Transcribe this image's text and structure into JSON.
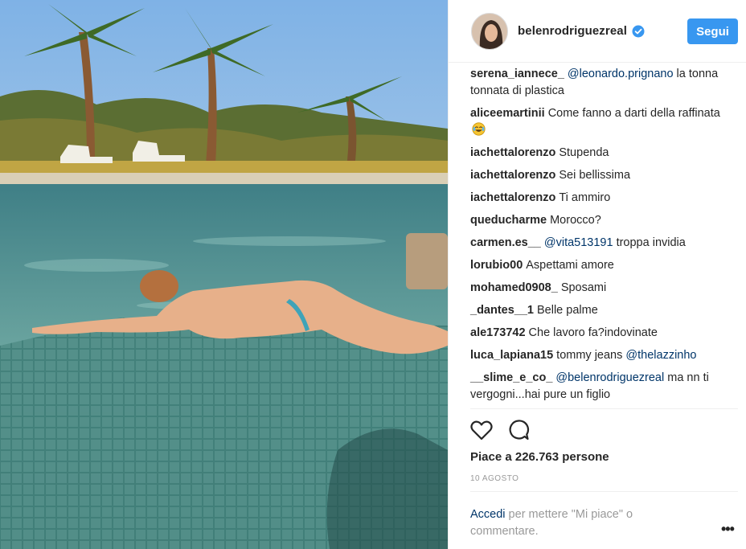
{
  "post": {
    "username": "belenrodriguezreal",
    "follow_label": "Segui",
    "likes_text": "Piace a 226.763 persone",
    "date": "10 AGOSTO",
    "login_link": "Accedi",
    "login_rest": " per mettere \"Mi piace\" o commentare.",
    "more_label": "•••"
  },
  "comments": [
    {
      "user": "serena_iannece_",
      "mention": "@leonardo.prignano",
      "text": " la tonna tonnata di plastica"
    },
    {
      "user": "aliceemartinii",
      "text": "Come fanno a darti della raffinata",
      "emoji": "crying-laughing-emoji"
    },
    {
      "user": "iachettalorenzo",
      "text": "Stupenda"
    },
    {
      "user": "iachettalorenzo",
      "text": "Sei bellissima"
    },
    {
      "user": "iachettalorenzo",
      "text": "Ti ammiro"
    },
    {
      "user": "queducharme",
      "text": "Morocco?"
    },
    {
      "user": "carmen.es__",
      "mention": "@vita513191",
      "text": " troppa invidia"
    },
    {
      "user": "lorubio00",
      "text": "Aspettami amore"
    },
    {
      "user": "mohamed0908_",
      "text": "Sposami"
    },
    {
      "user": "_dantes__1",
      "text": "Belle palme"
    },
    {
      "user": "ale173742",
      "text": "Che lavoro fa?indovinate"
    },
    {
      "user": "luca_lapiana15",
      "text": "tommy jeans ",
      "mention_after": "@thelazzinho"
    },
    {
      "user": "__slime_e_co_",
      "mention": "@belenrodriguezreal",
      "text": " ma nn ti vergogni...hai pure un figlio"
    }
  ],
  "icons": {
    "like": "heart-icon",
    "comment": "comment-bubble-icon",
    "verified": "verified-badge-icon"
  },
  "colors": {
    "follow_button": "#3897f0",
    "link": "#003569",
    "muted": "#999999"
  }
}
